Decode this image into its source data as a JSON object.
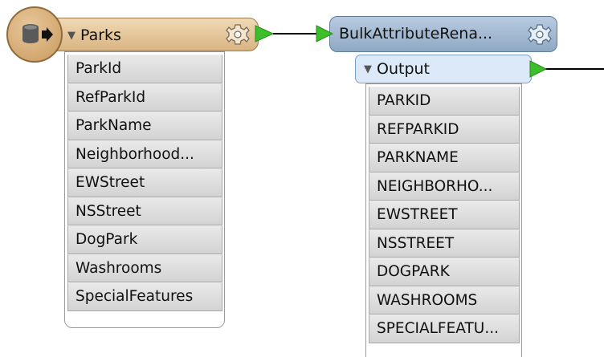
{
  "reader": {
    "name": "Parks",
    "attributes": [
      "ParkId",
      "RefParkId",
      "ParkName",
      "Neighborhood...",
      "EWStreet",
      "NSStreet",
      "DogPark",
      "Washrooms",
      "SpecialFeatures"
    ]
  },
  "transformer": {
    "name": "BulkAttributeRena...",
    "output_port": "Output",
    "attributes": [
      "PARKID",
      "REFPARKID",
      "PARKNAME",
      "NEIGHBORHO...",
      "EWSTREET",
      "NSSTREET",
      "DOGPARK",
      "WASHROOMS",
      "SPECIALFEATU..."
    ]
  },
  "icons": {
    "reader_icon": "database-reader-icon",
    "settings_icon": "gear-icon",
    "port_arrow": "green-port-arrow-icon"
  },
  "colors": {
    "reader_fill": "#d9b482",
    "transformer_fill": "#8fa9c4",
    "port_green": "#3cbf2a",
    "connection": "#000000"
  }
}
